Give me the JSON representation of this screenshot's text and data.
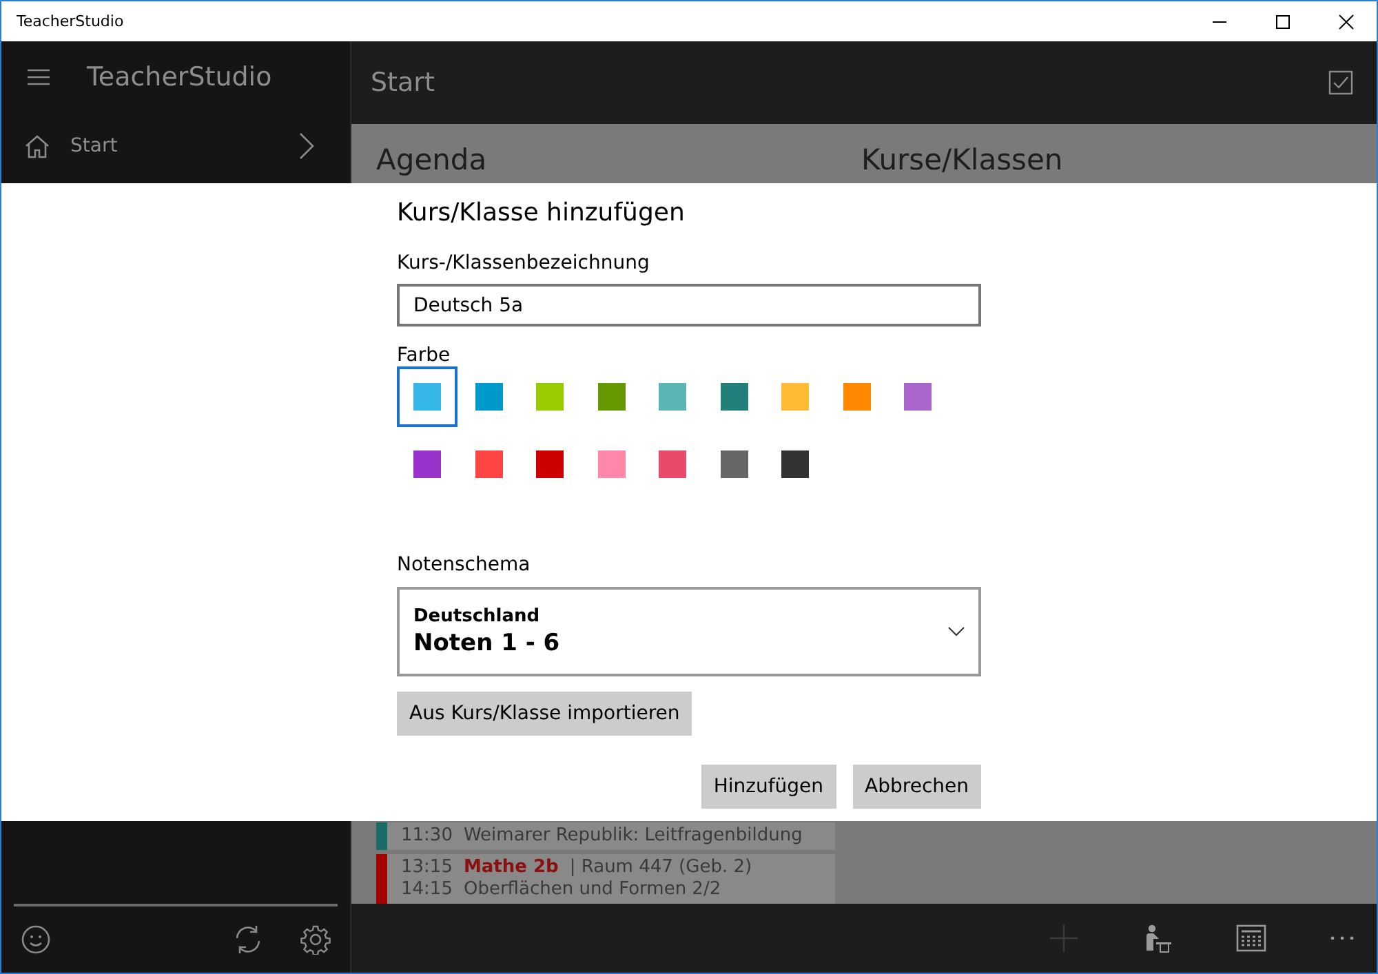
{
  "window": {
    "title": "TeacherStudio"
  },
  "app": {
    "title": "TeacherStudio"
  },
  "nav": [
    {
      "label": "Start"
    }
  ],
  "page": {
    "title": "Start"
  },
  "sections": [
    "Agenda",
    "Kurse/Klassen"
  ],
  "agenda": [
    {
      "color": "#1d6b66",
      "lines": [
        {
          "time": "11:30",
          "text": "Weimarer Republik: Leitfragenbildung"
        }
      ]
    },
    {
      "color": "#a30000",
      "lines": [
        {
          "time": "13:15",
          "course": "Mathe 2b",
          "text": "| Raum 447 (Geb. 2)"
        },
        {
          "time": "14:15",
          "text": "Oberflächen und Formen 2/2"
        }
      ]
    }
  ],
  "dialog": {
    "title": "Kurs/Klasse hinzufügen",
    "name_field": {
      "label": "Kurs-/Klassenbezeichnung",
      "value": "Deutsch 5a"
    },
    "color_label": "Farbe",
    "colors": [
      {
        "color": "#35b7e8",
        "selected": true
      },
      {
        "color": "#0099cc",
        "selected": false
      },
      {
        "color": "#99cc00",
        "selected": false
      },
      {
        "color": "#669900",
        "selected": false
      },
      {
        "color": "#5bb5b3",
        "selected": false
      },
      {
        "color": "#227f79",
        "selected": false
      },
      {
        "color": "#ffbb33",
        "selected": false
      },
      {
        "color": "#ff8800",
        "selected": false
      },
      {
        "color": "#aa66cc",
        "selected": false
      },
      {
        "color": "#9933cc",
        "selected": false
      },
      {
        "color": "#ff4444",
        "selected": false
      },
      {
        "color": "#cc0000",
        "selected": false
      },
      {
        "color": "#ff88aa",
        "selected": false
      },
      {
        "color": "#e84a6b",
        "selected": false
      },
      {
        "color": "#666666",
        "selected": false
      },
      {
        "color": "#333333",
        "selected": false
      }
    ],
    "grade_scheme": {
      "label": "Notenschema",
      "country": "Deutschland",
      "scheme": "Noten 1 - 6"
    },
    "import_button": "Aus Kurs/Klasse importieren",
    "buttons": [
      "Hinzufügen",
      "Abbrechen"
    ]
  }
}
